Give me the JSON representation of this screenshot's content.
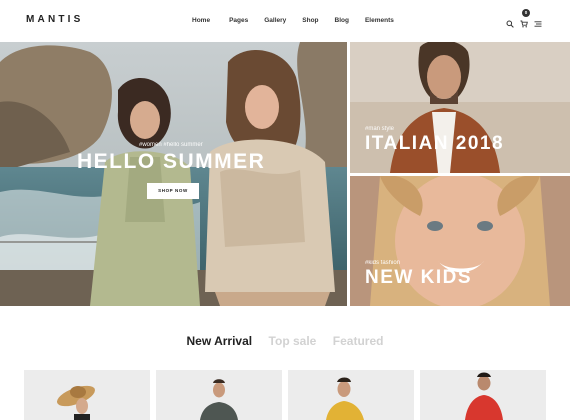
{
  "header": {
    "logo": "MANTIS",
    "nav": [
      "Home",
      "Pages",
      "Gallery",
      "Shop",
      "Blog",
      "Elements"
    ],
    "cart_count": "0",
    "icons": [
      "search-icon",
      "cart-icon",
      "menu-icon"
    ]
  },
  "hero": {
    "main": {
      "tags": "#women   #hello summer",
      "title": "HELLO SUMMER",
      "button": "SHOP NOW"
    },
    "top_right": {
      "tag": "#man style",
      "title": "ITALIAN 2018"
    },
    "bottom_right": {
      "tag": "#kids fashion",
      "title": "NEW KIDS"
    }
  },
  "tabs": [
    {
      "label": "New Arrival",
      "active": true
    },
    {
      "label": "Top sale",
      "active": false
    },
    {
      "label": "Featured",
      "active": false
    }
  ],
  "products": [
    {
      "name": "product-hat-woman"
    },
    {
      "name": "product-man-dark-shirt"
    },
    {
      "name": "product-man-yellow-shirt"
    },
    {
      "name": "product-man-red-polo"
    }
  ],
  "colors": {
    "text_dark": "#222222",
    "tab_inactive": "#d2d2d2",
    "product_bg": "#ececec"
  }
}
